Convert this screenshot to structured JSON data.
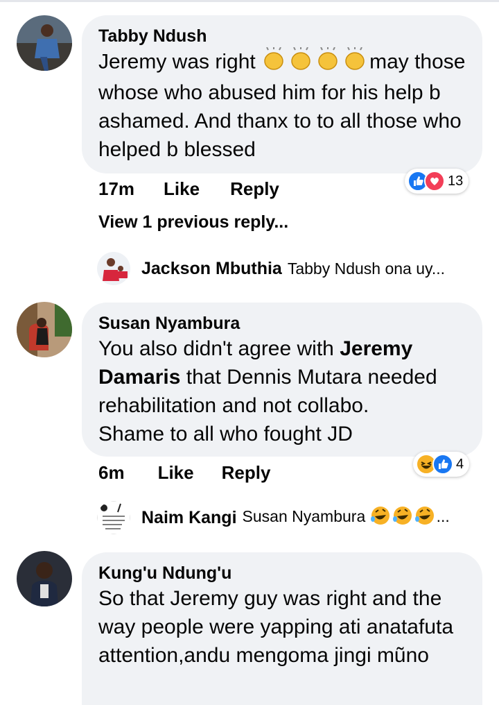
{
  "comments": [
    {
      "author": "Tabby Ndush",
      "text_plain": "Jeremy was right ",
      "text_after": "may those whose who abused him for his help b ashamed. And thanx to to all those who helped b blessed",
      "time": "17m",
      "like_label": "Like",
      "reply_label": "Reply",
      "reaction_count": "13",
      "reaction_icons": [
        "like-icon",
        "love-icon"
      ],
      "view_previous": "View 1 previous reply...",
      "reply": {
        "author": "Jackson Mbuthia",
        "text": "Tabby Ndush ona uy..."
      }
    },
    {
      "author": "Susan Nyambura",
      "text_before": "You also didn't agree with ",
      "text_bold": "Jeremy Damaris",
      "text_after": " that Dennis Mutara needed rehabilitation and not collabo.",
      "text_line2": "Shame to all who fought JD",
      "time": "6m",
      "like_label": "Like",
      "reply_label": "Reply",
      "reaction_count": "4",
      "reaction_icons": [
        "haha-icon",
        "like-icon"
      ],
      "reply": {
        "author": "Naim Kangi",
        "text": "Susan Nyambura",
        "ellipsis": "..."
      }
    },
    {
      "author": "Kung'u Ndung'u",
      "text": "So that Jeremy guy was right and the way people were yapping ati anatafuta attention,andu mengoma jingi mũno"
    }
  ],
  "colors": {
    "bubble": "#f0f2f5",
    "like_blue": "#1877f2",
    "love_red": "#f33e58",
    "haha_yellow": "#f7b125"
  }
}
